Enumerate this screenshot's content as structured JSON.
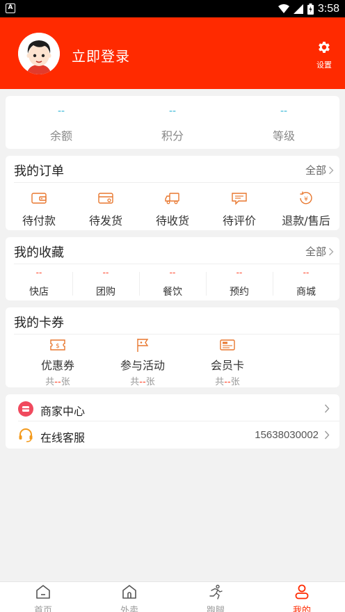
{
  "status_bar": {
    "time": "3:58"
  },
  "header": {
    "login_text": "立即登录",
    "settings_label": "设置"
  },
  "stats": [
    {
      "value": "--",
      "label": "余额"
    },
    {
      "value": "--",
      "label": "积分"
    },
    {
      "value": "--",
      "label": "等级"
    }
  ],
  "orders": {
    "title": "我的订单",
    "more": "全部",
    "items": [
      {
        "label": "待付款",
        "icon": "wallet-icon"
      },
      {
        "label": "待发货",
        "icon": "card-box-icon"
      },
      {
        "label": "待收货",
        "icon": "truck-icon"
      },
      {
        "label": "待评价",
        "icon": "comment-icon"
      },
      {
        "label": "退款/售后",
        "icon": "refund-icon"
      }
    ]
  },
  "favorites": {
    "title": "我的收藏",
    "more": "全部",
    "items": [
      {
        "value": "--",
        "label": "快店"
      },
      {
        "value": "--",
        "label": "团购"
      },
      {
        "value": "--",
        "label": "餐饮"
      },
      {
        "value": "--",
        "label": "预约"
      },
      {
        "value": "--",
        "label": "商城"
      }
    ]
  },
  "coupons": {
    "title": "我的卡券",
    "items": [
      {
        "label": "优惠券",
        "count_prefix": "共",
        "count": "--",
        "count_suffix": "张",
        "icon": "coupon-icon"
      },
      {
        "label": "参与活动",
        "count_prefix": "共",
        "count": "--",
        "count_suffix": "张",
        "icon": "flag-icon"
      },
      {
        "label": "会员卡",
        "count_prefix": "共",
        "count": "--",
        "count_suffix": "张",
        "icon": "member-card-icon"
      }
    ]
  },
  "links": [
    {
      "label": "商家中心",
      "value": "",
      "icon": "store-icon"
    },
    {
      "label": "在线客服",
      "value": "15638030002",
      "icon": "headset-icon"
    }
  ],
  "tabs": [
    {
      "label": "首页",
      "icon": "home-icon",
      "active": false
    },
    {
      "label": "外卖",
      "icon": "takeout-icon",
      "active": false
    },
    {
      "label": "跑腿",
      "icon": "runner-icon",
      "active": false
    },
    {
      "label": "我的",
      "icon": "user-icon",
      "active": true
    }
  ],
  "colors": {
    "brand": "#ff2a00",
    "stat_value": "#2bb3d6",
    "accent_dash": "#ff3b1f",
    "icon_orange": "#e8772e"
  }
}
